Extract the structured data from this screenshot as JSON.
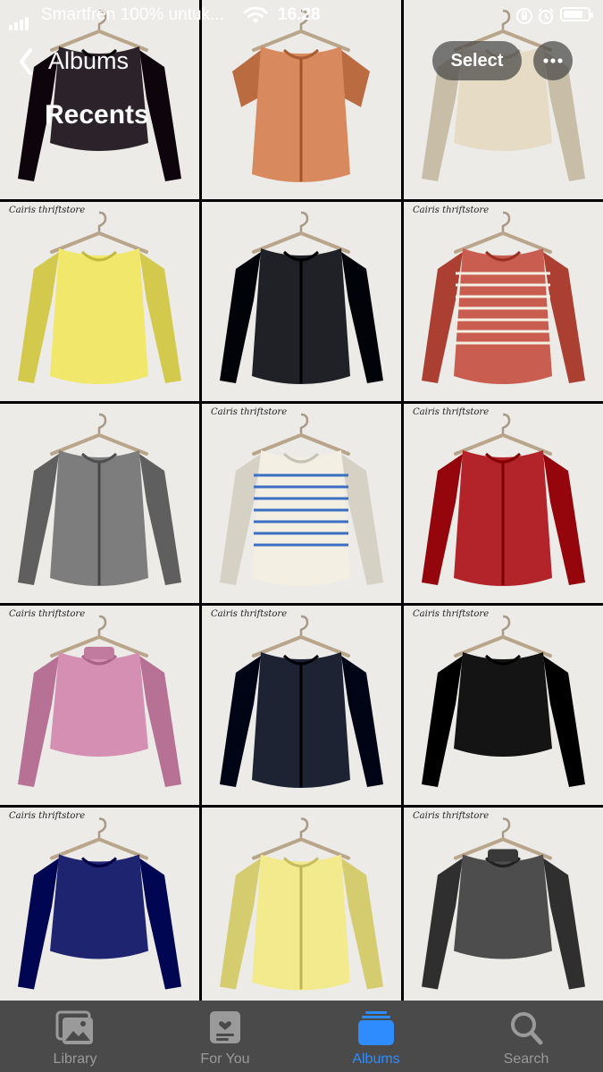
{
  "status_bar": {
    "carrier": "Smartfren 100% untuk...",
    "time": "16.28",
    "battery_level": 0.8
  },
  "nav": {
    "back_label": "Albums",
    "title": "Recents",
    "select_label": "Select"
  },
  "photos": [
    {
      "item": "long-sleeve-crop-top",
      "color": "#2b2329",
      "brand": ""
    },
    {
      "item": "short-sleeve-cardigan",
      "color": "#d9895e",
      "brand": ""
    },
    {
      "item": "long-sleeve-crop-top",
      "color": "#e6dcc6",
      "brand": ""
    },
    {
      "item": "long-sleeve-top",
      "color": "#f1e76a",
      "brand": "Cairis thriftstore"
    },
    {
      "item": "open-cardigan",
      "color": "#1f2126",
      "brand": ""
    },
    {
      "item": "striped-top",
      "color": "#c95e50",
      "brand": "Cairis thriftstore"
    },
    {
      "item": "cardigan",
      "color": "#7d7d7d",
      "brand": ""
    },
    {
      "item": "striped-top",
      "color": "#f3efe2",
      "brand": "Cairis thriftstore"
    },
    {
      "item": "open-cardigan",
      "color": "#b2232a",
      "brand": "Cairis thriftstore"
    },
    {
      "item": "polo-crop-top",
      "color": "#d48fb3",
      "brand": "Cairis thriftstore"
    },
    {
      "item": "open-cardigan",
      "color": "#1d2333",
      "brand": "Cairis thriftstore"
    },
    {
      "item": "long-sleeve-crop-top",
      "color": "#141414",
      "brand": "Cairis thriftstore"
    },
    {
      "item": "long-sleeve-crop-top",
      "color": "#1e2470",
      "brand": "Cairis thriftstore"
    },
    {
      "item": "cardigan",
      "color": "#f3ea8e",
      "brand": ""
    },
    {
      "item": "turtleneck-crop-top",
      "color": "#4d4d4d",
      "brand": "Cairis thriftstore"
    }
  ],
  "tabbar": {
    "tabs": [
      {
        "label": "Library",
        "icon": "photo-library-icon",
        "active": false
      },
      {
        "label": "For You",
        "icon": "for-you-icon",
        "active": false
      },
      {
        "label": "Albums",
        "icon": "albums-icon",
        "active": true
      },
      {
        "label": "Search",
        "icon": "search-icon",
        "active": false
      }
    ]
  },
  "colors": {
    "accent": "#2f8cff",
    "tabbar_bg": "#4a4a4a",
    "inactive_tab": "#9a9a9a"
  }
}
